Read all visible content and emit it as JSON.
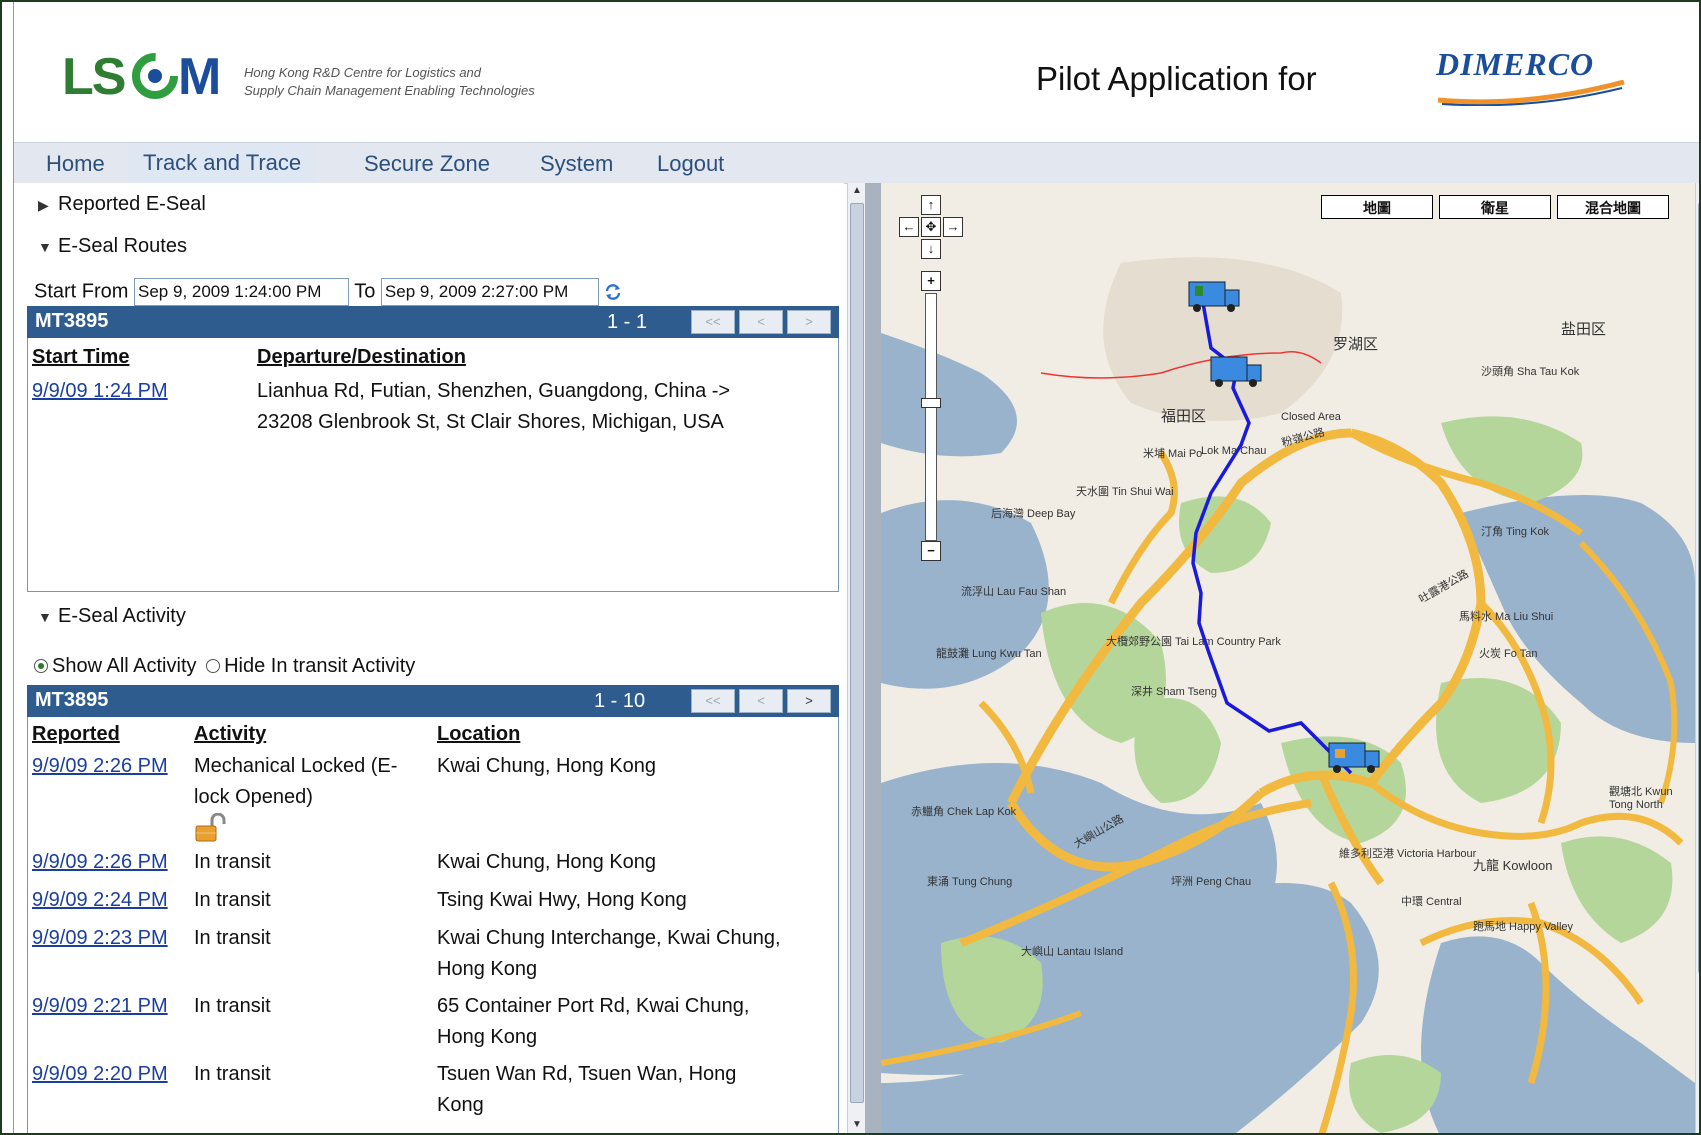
{
  "header": {
    "logo_text": "LSCM",
    "tagline_line1": "Hong Kong R&D Centre for Logistics and",
    "tagline_line2": "Supply Chain Management Enabling Technologies",
    "pilot_text": "Pilot Application for",
    "partner_logo_text": "DIMERCO"
  },
  "menu": {
    "items": [
      "Home",
      "Track and Trace",
      "Secure Zone",
      "System",
      "Logout"
    ],
    "active": "Track and Trace"
  },
  "sections": {
    "reported": "Reported E-Seal",
    "routes": "E-Seal Routes",
    "activity": "E-Seal Activity"
  },
  "dates": {
    "start_label": "Start From",
    "start_value": "Sep 9, 2009 1:24:00 PM",
    "to_label": "To",
    "end_value": "Sep 9, 2009 2:27:00 PM"
  },
  "routes_grid": {
    "title": "MT3895",
    "range": "1 - 1",
    "pager": [
      "<<",
      "<",
      ">"
    ],
    "headers": [
      "Start Time",
      "Departure/Destination"
    ],
    "rows": [
      {
        "time": "9/9/09 1:24 PM",
        "route_line1": "Lianhua Rd, Futian, Shenzhen, Guangdong, China ->",
        "route_line2": "23208 Glenbrook St, St Clair Shores, Michigan, USA"
      }
    ]
  },
  "activity_filter": {
    "show_all": "Show All Activity",
    "hide_transit": "Hide In transit Activity",
    "selected": "show_all"
  },
  "activity_grid": {
    "title": "MT3895",
    "range": "1 - 10",
    "pager": [
      "<<",
      "<",
      ">"
    ],
    "headers": [
      "Reported",
      "Activity",
      "Location"
    ],
    "rows": [
      {
        "time": "9/9/09 2:26 PM",
        "activity_line1": "Mechanical Locked (E-",
        "activity_line2": "lock Opened)",
        "location_line1": "Kwai Chung, Hong Kong",
        "location_line2": "",
        "icon": "padlock-open-icon"
      },
      {
        "time": "9/9/09 2:26 PM",
        "activity_line1": "In transit",
        "activity_line2": "",
        "location_line1": "Kwai Chung, Hong Kong",
        "location_line2": ""
      },
      {
        "time": "9/9/09 2:24 PM",
        "activity_line1": "In transit",
        "activity_line2": "",
        "location_line1": "Tsing Kwai Hwy, Hong Kong",
        "location_line2": ""
      },
      {
        "time": "9/9/09 2:23 PM",
        "activity_line1": "In transit",
        "activity_line2": "",
        "location_line1": "Kwai Chung Interchange, Kwai Chung,",
        "location_line2": "Hong Kong"
      },
      {
        "time": "9/9/09 2:21 PM",
        "activity_line1": "In transit",
        "activity_line2": "",
        "location_line1": "65 Container Port Rd, Kwai Chung,",
        "location_line2": "Hong Kong"
      },
      {
        "time": "9/9/09 2:20 PM",
        "activity_line1": "In transit",
        "activity_line2": "",
        "location_line1": "Tsuen Wan Rd, Tsuen Wan, Hong",
        "location_line2": "Kong"
      }
    ]
  },
  "map": {
    "type_buttons": [
      "地圖",
      "衛星",
      "混合地圖"
    ],
    "labels": [
      "罗湖区",
      "盐田区",
      "福田区",
      "Closed Area",
      "Lok Ma Chau",
      "米埔 Mai Po",
      "天水圍 Tin Shui Wai",
      "后海灣 Deep Bay",
      "流浮山 Lau Fau Shan",
      "龍鼓灘 Lung Kwu Tan",
      "大欖郊野公園 Tai Lam Country Park",
      "深井 Sham Tseng",
      "馬料水 Ma Liu Shui",
      "火炭 Fo Tan",
      "九龍 Kowloon",
      "中環 Central",
      "跑馬地 Happy Valley",
      "維多利亞港 Victoria Harbour",
      "赤鱲角 Chek Lap Kok",
      "東涌 Tung Chung",
      "坪洲 Peng Chau",
      "大嶼山 Lantau Island",
      "大嶼山公路",
      "粉嶺公路",
      "吐露港公路",
      "沙頭角 Sha Tau Kok",
      "汀角 Ting Kok",
      "觀塘北 Kwun Tong North"
    ],
    "route_color": "#1a1adb"
  },
  "colors": {
    "menu_text": "#2c4f7c",
    "grid_header": "#2f5c8f",
    "link": "#1a3fa0",
    "logo_green": "#2e7d32",
    "logo_blue": "#1a4d9c"
  }
}
